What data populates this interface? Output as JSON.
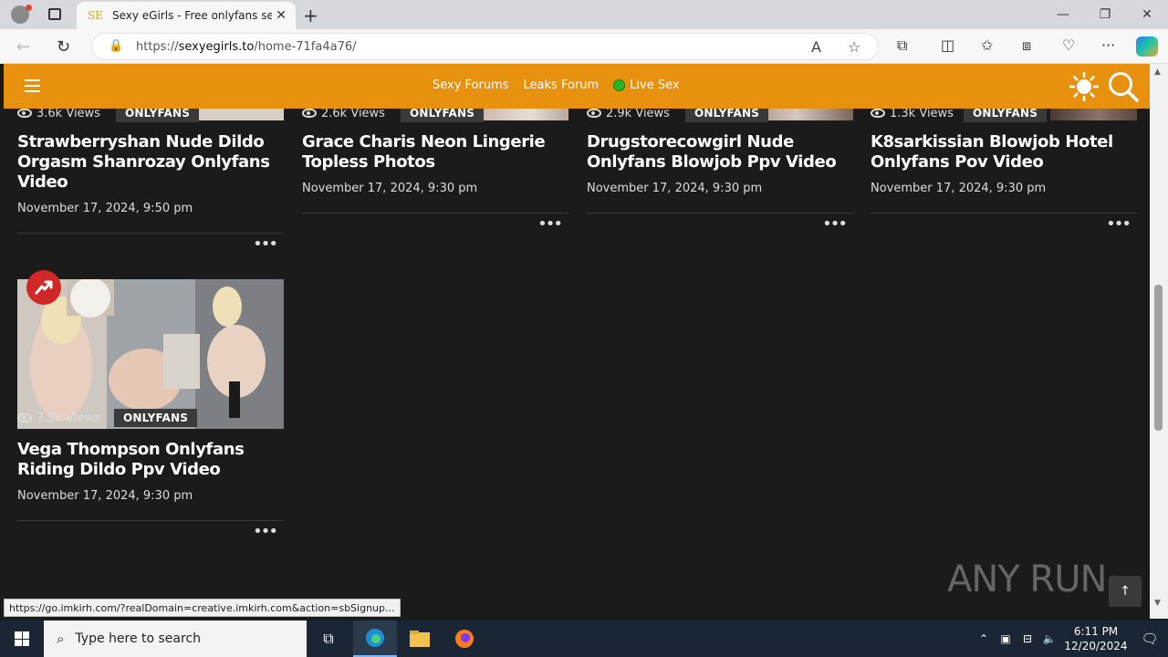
{
  "browser": {
    "tab_title": "Sexy eGirls - Free onlyfans sexy n",
    "tab_favicon": "SE",
    "url_prefix": "https://",
    "url_host": "sexyegirls.to",
    "url_path": "/home-71fa4a76/",
    "status_url": "https://go.imkirh.com/?realDomain=creative.imkirh.com&action=sbSignup..."
  },
  "site": {
    "nav": [
      "Sexy Forums",
      "Leaks Forum",
      "Live Sex"
    ],
    "accent": "#e8910e"
  },
  "cards": [
    {
      "views": "3.6k Views",
      "badge": "ONLYFANS",
      "title": "Strawberryshan Nude Dildo Orgasm Shanrozay Onlyfans Video",
      "date": "November 17, 2024, 9:50 pm"
    },
    {
      "views": "2.6k Views",
      "badge": "ONLYFANS",
      "title": "Grace Charis Neon Lingerie Topless Photos",
      "date": "November 17, 2024, 9:30 pm"
    },
    {
      "views": "2.9k Views",
      "badge": "ONLYFANS",
      "title": "Drugstorecowgirl Nude Onlyfans Blowjob Ppv Video",
      "date": "November 17, 2024, 9:30 pm"
    },
    {
      "views": "1.3k Views",
      "badge": "ONLYFANS",
      "title": "K8sarkissian Blowjob Hotel Onlyfans Pov Video",
      "date": "November 17, 2024, 9:30 pm"
    },
    {
      "views": "7.2k Views",
      "badge": "ONLYFANS",
      "title": "Vega Thompson Onlyfans Riding Dildo Ppv Video",
      "date": "November 17, 2024, 9:30 pm"
    }
  ],
  "watermark": "ANY RUN",
  "taskbar": {
    "search_placeholder": "Type here to search",
    "time": "6:11 PM",
    "date": "12/20/2024"
  }
}
